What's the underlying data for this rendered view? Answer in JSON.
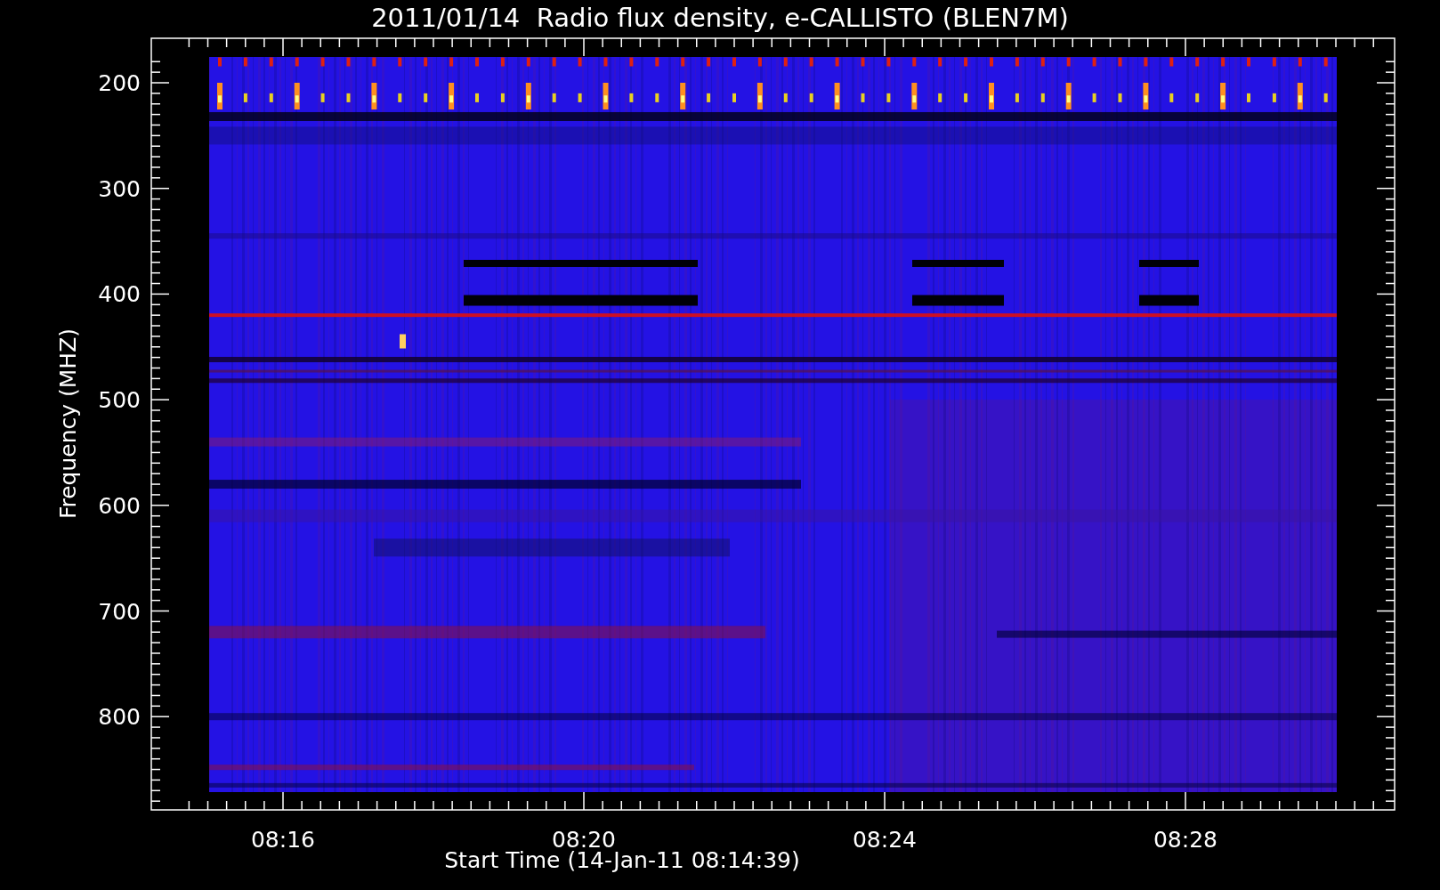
{
  "plot": {
    "title": "2011/01/14  Radio flux density, e-CALLISTO (BLEN7M)",
    "ylabel": "Frequency (MHZ)",
    "xlabel": "Start Time (14-Jan-11 08:14:39)",
    "yticks": [
      "200",
      "300",
      "400",
      "500",
      "600",
      "700",
      "800"
    ],
    "xticks": [
      "08:16",
      "08:20",
      "08:24",
      "08:28"
    ]
  }
}
